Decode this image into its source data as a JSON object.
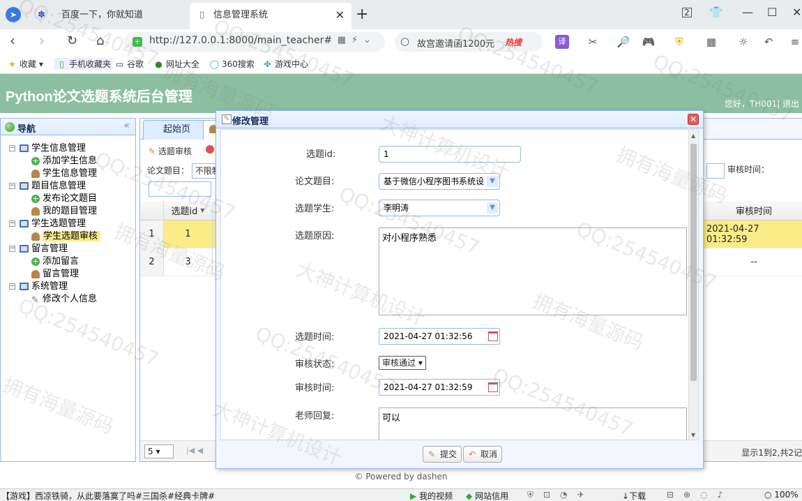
{
  "browser": {
    "tabs": [
      {
        "title": "百度一下，你就知道",
        "icon": "baidu-paw-icon"
      },
      {
        "title": "信息管理系统",
        "icon": "page-icon"
      }
    ],
    "url": "http://127.0.0.1:8000/main_teacher#",
    "search_text": "故宫邀请函1200元",
    "search_badge": "热搜",
    "tab_count": "2",
    "bookmarks": [
      "收藏",
      "手机收藏夹",
      "谷歌",
      "网址大全",
      "360搜索",
      "游戏中心"
    ]
  },
  "app": {
    "title": "Python论文选题系统后台管理",
    "user_text": "您好，TH001| 退出"
  },
  "sidebar": {
    "title": "导航",
    "groups": [
      {
        "label": "学生信息管理",
        "items": [
          "添加学生信息",
          "学生信息管理"
        ]
      },
      {
        "label": "题目信息管理",
        "items": [
          "发布论文题目",
          "我的题目管理"
        ]
      },
      {
        "label": "学生选题管理",
        "items": [
          "学生选题审核"
        ]
      },
      {
        "label": "留言管理",
        "items": [
          "添加留言",
          "留言管理"
        ]
      },
      {
        "label": "系统管理",
        "items": [
          "修改个人信息"
        ]
      }
    ]
  },
  "main": {
    "tabs": [
      "起始页",
      ""
    ],
    "toolbar": {
      "audit": "选题审核"
    },
    "filter": {
      "topic_label": "论文题目：",
      "topic_value": "不限制",
      "audit_time_label": "审核时间："
    },
    "grid": {
      "columns": {
        "id": "选题id",
        "audit_time": "审核时间"
      },
      "rows": [
        {
          "num": "1",
          "id": "1",
          "audit_time": "2021-04-27 01:32:59"
        },
        {
          "num": "2",
          "id": "3",
          "audit_time": "--"
        }
      ]
    },
    "pager": {
      "page_size": "5",
      "info": "显示1到2,共2记"
    }
  },
  "dialog": {
    "title": "修改管理",
    "fields": {
      "id_label": "选题id:",
      "id_value": "1",
      "topic_label": "论文题目:",
      "topic_value": "基于微信小程序图书系统设",
      "student_label": "选题学生:",
      "student_value": "李明涛",
      "reason_label": "选题原因:",
      "reason_value": "对小程序熟悉",
      "select_time_label": "选题时间:",
      "select_time_value": "2021-04-27 01:32:56",
      "status_label": "审核状态:",
      "status_value": "审核通过",
      "audit_time_label": "审核时间:",
      "audit_time_value": "2021-04-27 01:32:59",
      "reply_label": "老师回复:",
      "reply_value": "可以"
    },
    "buttons": {
      "submit": "提交",
      "cancel": "取消"
    }
  },
  "footer": {
    "powered": "© Powered by dashen"
  },
  "statusbar": {
    "news": "【游戏】西凉铁骑，从此要落寞了吗#三国杀#经典卡牌#",
    "video": "我的视频",
    "credit": "网站信用",
    "download": "下载",
    "zoom": "100%"
  },
  "watermarks": [
    "QQ:254540457",
    "拥有海量源码",
    "大神计算机设计"
  ],
  "colors": {
    "header": "#8cbfa1",
    "border": "#95b8e7",
    "selected": "#fbec88"
  }
}
